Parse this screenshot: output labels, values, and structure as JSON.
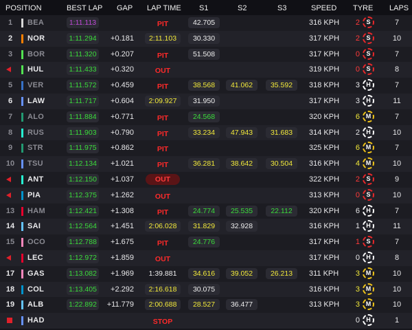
{
  "header": {
    "position": "POSITION",
    "best_lap": "BEST LAP",
    "gap": "GAP",
    "lap_time": "LAP TIME",
    "s1": "S1",
    "s2": "S2",
    "s3": "S3",
    "speed": "SPEED",
    "tyre": "TYRE",
    "laps": "LAPS"
  },
  "colors": {
    "accent_green": "#3bdc3b",
    "accent_yellow": "#f2e93a",
    "accent_purple": "#c04bd8",
    "status_red": "#ff2a2a"
  },
  "rows": [
    {
      "pos": "1",
      "marker": "",
      "dim": true,
      "team_color": "#d8d8d8",
      "driver": "BEA",
      "best": "1:11.113",
      "best_purple": true,
      "gap": "",
      "lap": "PIT",
      "lap_style": "pit",
      "s1": "42.705",
      "s1c": "w",
      "s2": "",
      "s2c": "",
      "s3": "",
      "s3c": "",
      "speed": "316 KPH",
      "tyre_age": "2",
      "age_style": "red",
      "tyre": "S",
      "laps": "7"
    },
    {
      "pos": "2",
      "marker": "",
      "dim": false,
      "team_color": "#ff8000",
      "driver": "NOR",
      "best": "1:11.294",
      "best_purple": false,
      "gap": "+0.181",
      "lap": "2:11.103",
      "lap_style": "y",
      "s1": "30.330",
      "s1c": "w",
      "s2": "",
      "s2c": "",
      "s3": "",
      "s3c": "",
      "speed": "317 KPH",
      "tyre_age": "2",
      "age_style": "red",
      "tyre": "S",
      "laps": "10"
    },
    {
      "pos": "3",
      "marker": "",
      "dim": true,
      "team_color": "#52e252",
      "driver": "BOR",
      "best": "1:11.320",
      "best_purple": false,
      "gap": "+0.207",
      "lap": "PIT",
      "lap_style": "pit",
      "s1": "51.508",
      "s1c": "w",
      "s2": "",
      "s2c": "",
      "s3": "",
      "s3c": "",
      "speed": "317 KPH",
      "tyre_age": "0",
      "age_style": "red",
      "tyre": "S",
      "laps": "7"
    },
    {
      "pos": "",
      "marker": "arrow",
      "dim": false,
      "team_color": "#52e252",
      "driver": "HUL",
      "best": "1:11.433",
      "best_purple": false,
      "gap": "+0.320",
      "lap": "OUT",
      "lap_style": "out",
      "s1": "",
      "s1c": "",
      "s2": "",
      "s2c": "",
      "s3": "",
      "s3c": "",
      "speed": "319 KPH",
      "tyre_age": "0",
      "age_style": "red",
      "tyre": "S",
      "laps": "8"
    },
    {
      "pos": "5",
      "marker": "",
      "dim": true,
      "team_color": "#3671c6",
      "driver": "VER",
      "best": "1:11.572",
      "best_purple": false,
      "gap": "+0.459",
      "lap": "PIT",
      "lap_style": "pit",
      "s1": "38.568",
      "s1c": "y",
      "s2": "41.062",
      "s2c": "y",
      "s3": "35.592",
      "s3c": "y",
      "speed": "318 KPH",
      "tyre_age": "3",
      "age_style": "",
      "tyre": "H",
      "laps": "7"
    },
    {
      "pos": "6",
      "marker": "",
      "dim": false,
      "team_color": "#6692ff",
      "driver": "LAW",
      "best": "1:11.717",
      "best_purple": false,
      "gap": "+0.604",
      "lap": "2:09.927",
      "lap_style": "y",
      "s1": "31.950",
      "s1c": "w",
      "s2": "",
      "s2c": "",
      "s3": "",
      "s3c": "",
      "speed": "317 KPH",
      "tyre_age": "3",
      "age_style": "",
      "tyre": "H",
      "laps": "11"
    },
    {
      "pos": "7",
      "marker": "",
      "dim": true,
      "team_color": "#229971",
      "driver": "ALO",
      "best": "1:11.884",
      "best_purple": false,
      "gap": "+0.771",
      "lap": "PIT",
      "lap_style": "pit",
      "s1": "24.568",
      "s1c": "g",
      "s2": "",
      "s2c": "",
      "s3": "",
      "s3c": "",
      "speed": "320 KPH",
      "tyre_age": "6",
      "age_style": "yel",
      "tyre": "M",
      "laps": "7"
    },
    {
      "pos": "8",
      "marker": "",
      "dim": true,
      "team_color": "#27f4d2",
      "driver": "RUS",
      "best": "1:11.903",
      "best_purple": false,
      "gap": "+0.790",
      "lap": "PIT",
      "lap_style": "pit",
      "s1": "33.234",
      "s1c": "y",
      "s2": "47.943",
      "s2c": "y",
      "s3": "31.683",
      "s3c": "y",
      "speed": "314 KPH",
      "tyre_age": "2",
      "age_style": "",
      "tyre": "H",
      "laps": "10"
    },
    {
      "pos": "9",
      "marker": "",
      "dim": true,
      "team_color": "#229971",
      "driver": "STR",
      "best": "1:11.975",
      "best_purple": false,
      "gap": "+0.862",
      "lap": "PIT",
      "lap_style": "pit",
      "s1": "",
      "s1c": "",
      "s2": "",
      "s2c": "",
      "s3": "",
      "s3c": "",
      "speed": "325 KPH",
      "tyre_age": "6",
      "age_style": "yel",
      "tyre": "M",
      "laps": "7"
    },
    {
      "pos": "10",
      "marker": "",
      "dim": true,
      "team_color": "#6692ff",
      "driver": "TSU",
      "best": "1:12.134",
      "best_purple": false,
      "gap": "+1.021",
      "lap": "PIT",
      "lap_style": "pit",
      "s1": "36.281",
      "s1c": "y",
      "s2": "38.642",
      "s2c": "y",
      "s3": "30.504",
      "s3c": "y",
      "speed": "316 KPH",
      "tyre_age": "4",
      "age_style": "yel",
      "tyre": "M",
      "laps": "10"
    },
    {
      "pos": "",
      "marker": "arrow",
      "dim": false,
      "team_color": "#27f4d2",
      "driver": "ANT",
      "best": "1:12.150",
      "best_purple": false,
      "gap": "+1.037",
      "lap": "OUT",
      "lap_style": "outpill",
      "s1": "",
      "s1c": "",
      "s2": "",
      "s2c": "",
      "s3": "",
      "s3c": "",
      "speed": "322 KPH",
      "tyre_age": "2",
      "age_style": "red",
      "tyre": "S",
      "laps": "9"
    },
    {
      "pos": "",
      "marker": "arrow",
      "dim": false,
      "team_color": "#0093cc",
      "driver": "PIA",
      "best": "1:12.375",
      "best_purple": false,
      "gap": "+1.262",
      "lap": "OUT",
      "lap_style": "out",
      "s1": "",
      "s1c": "",
      "s2": "",
      "s2c": "",
      "s3": "",
      "s3c": "",
      "speed": "313 KPH",
      "tyre_age": "0",
      "age_style": "red",
      "tyre": "S",
      "laps": "10"
    },
    {
      "pos": "13",
      "marker": "",
      "dim": true,
      "team_color": "#e8002d",
      "driver": "HAM",
      "best": "1:12.421",
      "best_purple": false,
      "gap": "+1.308",
      "lap": "PIT",
      "lap_style": "pit",
      "s1": "24.774",
      "s1c": "g",
      "s2": "25.535",
      "s2c": "g",
      "s3": "22.112",
      "s3c": "g",
      "speed": "320 KPH",
      "tyre_age": "6",
      "age_style": "",
      "tyre": "H",
      "laps": "7"
    },
    {
      "pos": "14",
      "marker": "",
      "dim": false,
      "team_color": "#64c4ff",
      "driver": "SAI",
      "best": "1:12.564",
      "best_purple": false,
      "gap": "+1.451",
      "lap": "2:06.028",
      "lap_style": "y",
      "s1": "31.829",
      "s1c": "y",
      "s2": "32.928",
      "s2c": "w",
      "s3": "",
      "s3c": "",
      "speed": "316 KPH",
      "tyre_age": "1",
      "age_style": "",
      "tyre": "H",
      "laps": "11"
    },
    {
      "pos": "15",
      "marker": "",
      "dim": true,
      "team_color": "#ff87bc",
      "driver": "OCO",
      "best": "1:12.788",
      "best_purple": false,
      "gap": "+1.675",
      "lap": "PIT",
      "lap_style": "pit",
      "s1": "24.776",
      "s1c": "g",
      "s2": "",
      "s2c": "",
      "s3": "",
      "s3c": "",
      "speed": "317 KPH",
      "tyre_age": "1",
      "age_style": "red",
      "tyre": "S",
      "laps": "7"
    },
    {
      "pos": "",
      "marker": "arrow",
      "dim": false,
      "team_color": "#e8002d",
      "driver": "LEC",
      "best": "1:12.972",
      "best_purple": false,
      "gap": "+1.859",
      "lap": "OUT",
      "lap_style": "out",
      "s1": "",
      "s1c": "",
      "s2": "",
      "s2c": "",
      "s3": "",
      "s3c": "",
      "speed": "317 KPH",
      "tyre_age": "0",
      "age_style": "",
      "tyre": "H",
      "laps": "8"
    },
    {
      "pos": "17",
      "marker": "",
      "dim": false,
      "team_color": "#ff87bc",
      "driver": "GAS",
      "best": "1:13.082",
      "best_purple": false,
      "gap": "+1.969",
      "lap": "1:39.881",
      "lap_style": "w",
      "s1": "34.616",
      "s1c": "y",
      "s2": "39.052",
      "s2c": "y",
      "s3": "26.213",
      "s3c": "y",
      "speed": "311 KPH",
      "tyre_age": "3",
      "age_style": "yel",
      "tyre": "M",
      "laps": "10"
    },
    {
      "pos": "18",
      "marker": "",
      "dim": false,
      "team_color": "#0093cc",
      "driver": "COL",
      "best": "1:13.405",
      "best_purple": false,
      "gap": "+2.292",
      "lap": "2:16.618",
      "lap_style": "y",
      "s1": "30.075",
      "s1c": "w",
      "s2": "",
      "s2c": "",
      "s3": "",
      "s3c": "",
      "speed": "316 KPH",
      "tyre_age": "3",
      "age_style": "yel",
      "tyre": "M",
      "laps": "10"
    },
    {
      "pos": "19",
      "marker": "",
      "dim": false,
      "team_color": "#64c4ff",
      "driver": "ALB",
      "best": "1:22.892",
      "best_purple": false,
      "gap": "+11.779",
      "lap": "2:00.688",
      "lap_style": "y",
      "s1": "28.527",
      "s1c": "y",
      "s2": "36.477",
      "s2c": "w",
      "s3": "",
      "s3c": "",
      "speed": "313 KPH",
      "tyre_age": "3",
      "age_style": "yel",
      "tyre": "M",
      "laps": "10"
    },
    {
      "pos": "",
      "marker": "stop",
      "dim": false,
      "team_color": "#6692ff",
      "driver": "HAD",
      "best": "",
      "best_purple": false,
      "gap": "",
      "lap": "STOP",
      "lap_style": "stop",
      "s1": "",
      "s1c": "",
      "s2": "",
      "s2c": "",
      "s3": "",
      "s3c": "",
      "speed": "",
      "tyre_age": "0",
      "age_style": "",
      "tyre": "H",
      "laps": "1"
    }
  ]
}
